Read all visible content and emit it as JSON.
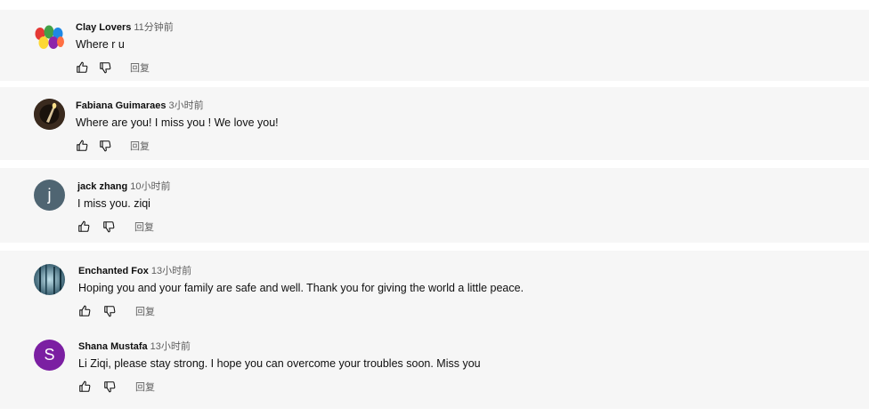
{
  "comments": [
    {
      "author": "Clay Lovers",
      "time": "11分钟前",
      "text": "Where r u",
      "reply_label": "回复",
      "avatar_kind": "colorful-eggs"
    },
    {
      "author": "Fabiana Guimaraes",
      "time": "3小时前",
      "text": "Where are you! I miss you ! We love you!",
      "reply_label": "回复",
      "avatar_kind": "photo-candle"
    },
    {
      "author": "jack zhang",
      "time": "10小时前",
      "text": "I miss you. ziqi",
      "reply_label": "回复",
      "avatar_letter": "j",
      "avatar_color": "#4f6572"
    },
    {
      "author": "Enchanted Fox",
      "time": "13小时前",
      "text": "Hoping you and your family are safe and well. Thank you for giving the world a little peace.",
      "reply_label": "回复",
      "avatar_kind": "photo-forest"
    },
    {
      "author": "Shana Mustafa",
      "time": "13小时前",
      "text": "Li Ziqi, please stay strong. I hope you can overcome your troubles soon. Miss you",
      "reply_label": "回复",
      "avatar_letter": "S",
      "avatar_color": "#7b1fa2"
    }
  ],
  "icons": {
    "like": "thumbs-up-icon",
    "dislike": "thumbs-down-icon"
  },
  "colors": {
    "card_bg": "#f6f6f6",
    "secondary_text": "#606060"
  }
}
